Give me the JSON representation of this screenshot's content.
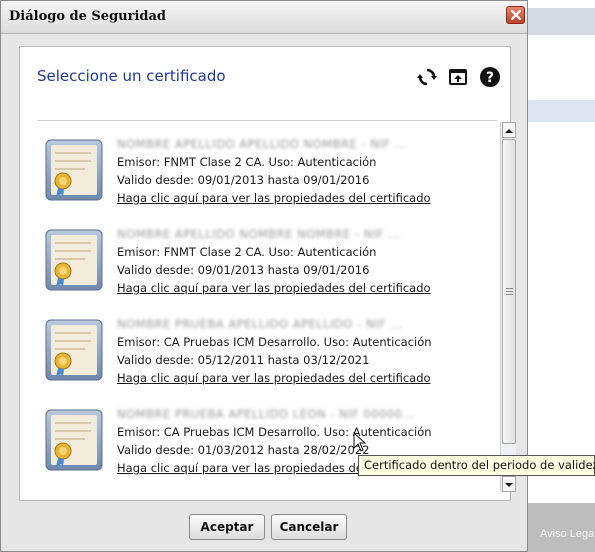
{
  "background": {
    "footer_text": "Aviso Legal |"
  },
  "dialog": {
    "title": "Diálogo de Seguridad",
    "heading": "Seleccione un certificado",
    "toolbar": {
      "refresh_icon": "refresh-icon",
      "open_icon": "open-file-icon",
      "help_icon": "help-icon"
    }
  },
  "certificates": [
    {
      "name": "NOMBRE APELLIDO APELLIDO NOMBRE - NIF ...",
      "issuer": "Emisor: FNMT Clase 2 CA. Uso: Autenticación",
      "validity": "Valido desde: 09/01/2013 hasta 09/01/2016",
      "link": "Haga clic aquí para ver las propiedades del certificado"
    },
    {
      "name": "NOMBRE APELLIDO NOMBRE NOMBRE - NIF ...",
      "issuer": "Emisor: FNMT Clase 2 CA. Uso: Autenticación",
      "validity": "Valido desde: 09/01/2013 hasta 09/01/2016",
      "link": "Haga clic aquí para ver las propiedades del certificado"
    },
    {
      "name": "NOMBRE PRUEBA APELLIDO APELLIDO - NIF ...",
      "issuer": "Emisor: CA Pruebas ICM Desarrollo. Uso: Autenticación",
      "validity": "Valido desde: 05/12/2011 hasta 03/12/2021",
      "link": "Haga clic aquí para ver las propiedades del certificado"
    },
    {
      "name": "NOMBRE PRUEBA APELLIDO LEON - NIF 00000...",
      "issuer": "Emisor: CA Pruebas ICM Desarrollo. Uso: Autenticación",
      "validity": "Valido desde: 01/03/2012 hasta 28/02/2022",
      "link": "Haga clic aquí para ver las propiedades del certificado"
    }
  ],
  "buttons": {
    "ok": "Aceptar",
    "cancel": "Cancelar"
  },
  "tooltip": "Certificado dentro del periodo de validez",
  "colors": {
    "heading": "#1d3a9a",
    "tooltip_bg": "#ffffe1",
    "close_button": "#c0402a"
  }
}
